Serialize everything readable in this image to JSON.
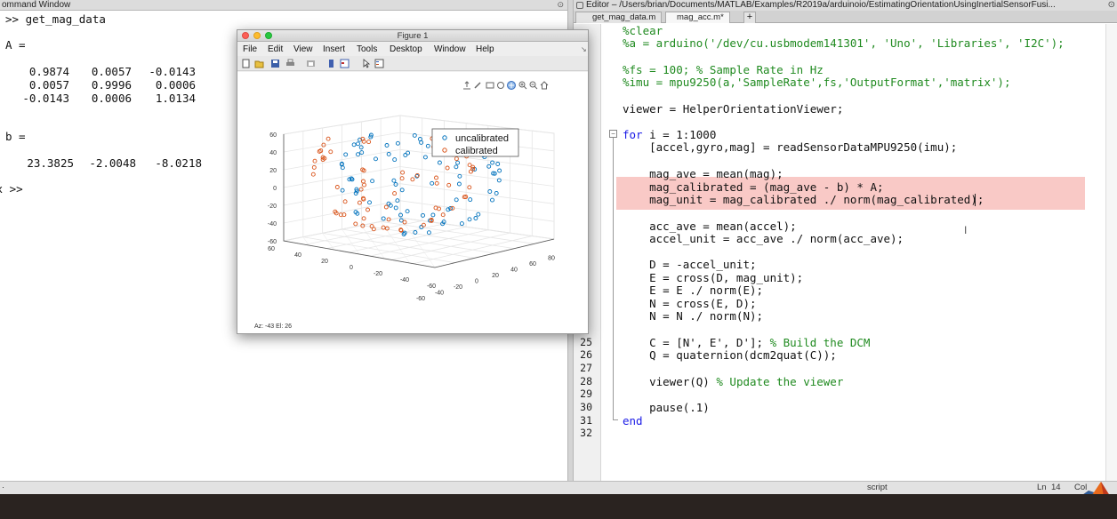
{
  "command_window": {
    "title": "ommand Window",
    "lines": [
      ">> get_mag_data",
      "A =",
      "b =",
      "fx >>"
    ],
    "matrix_A": [
      [
        "0.9874",
        "0.0057",
        "-0.0143"
      ],
      [
        "0.0057",
        "0.9996",
        "0.0006"
      ],
      [
        "-0.0143",
        "0.0006",
        "1.0134"
      ]
    ],
    "vector_b": [
      "23.3825",
      "-2.0048",
      "-8.0218"
    ]
  },
  "editor": {
    "title": "Editor – /Users/brian/Documents/MATLAB/Examples/R2019a/arduinoio/EstimatingOrientationUsingInertialSensorFusi...",
    "tabs": [
      {
        "label": "get_mag_data.m"
      },
      {
        "label": "mag_acc.m*"
      }
    ],
    "add_tab": "+",
    "line_numbers": [
      "25",
      "26",
      "27",
      "28",
      "29",
      "30",
      "31",
      "32"
    ],
    "code": [
      {
        "text": "%clear",
        "style": "cmt"
      },
      {
        "text": "%a = arduino('/dev/cu.usbmodem141301', 'Uno', 'Libraries', 'I2C');",
        "style": "cmt"
      },
      {
        "text": "%fs = 100; % Sample Rate in Hz",
        "style": "cmt"
      },
      {
        "text": "%imu = mpu9250(a,'SampleRate',fs,'OutputFormat','matrix');",
        "style": "cmt"
      },
      {
        "text": "viewer = HelperOrientationViewer;",
        "style": "plain"
      },
      {
        "text": "for",
        "style": "kw",
        "rest": " i = 1:1000"
      },
      {
        "text": "    [accel,gyro,mag] = readSensorDataMPU9250(imu);",
        "style": "plain"
      },
      {
        "text": "    mag_ave = mean(mag);",
        "style": "plain"
      },
      {
        "text": "    mag_calibrated = (mag_ave - b) * A;",
        "style": "plain"
      },
      {
        "text": "    mag_unit = mag_calibrated ./ norm(mag_calibrated);",
        "style": "plain"
      },
      {
        "text": "    acc_ave = mean(accel);",
        "style": "plain"
      },
      {
        "text": "    accel_unit = acc_ave ./ norm(acc_ave);",
        "style": "plain"
      },
      {
        "text": "    D = -accel_unit;",
        "style": "plain"
      },
      {
        "text": "    E = cross(D, mag_unit);",
        "style": "plain"
      },
      {
        "text": "    E = E ./ norm(E);",
        "style": "plain"
      },
      {
        "text": "    N = cross(E, D);",
        "style": "plain"
      },
      {
        "text": "    N = N ./ norm(N);",
        "style": "plain"
      },
      {
        "text": "    C = [N', E', D'];",
        "style": "plain",
        "comment": " % Build the DCM"
      },
      {
        "text": "    Q = quaternion(dcm2quat(C));",
        "style": "plain"
      },
      {
        "text": "    viewer(Q)",
        "style": "plain",
        "comment": " % Update the viewer"
      },
      {
        "text": "    pause(.1)",
        "style": "plain"
      },
      {
        "text": "end",
        "style": "kw"
      }
    ]
  },
  "status_bar": {
    "file_type": "script",
    "ln_label": "Ln",
    "ln_value": "14",
    "col_label": "Col"
  },
  "figure": {
    "title": "Figure 1",
    "menu": [
      "File",
      "Edit",
      "View",
      "Insert",
      "Tools",
      "Desktop",
      "Window",
      "Help"
    ],
    "az_el": "Az: -43 El: 26",
    "chart_data": {
      "type": "scatter",
      "title": "",
      "legend_position": "top-right",
      "series": [
        {
          "name": "uncalibrated",
          "color": "#0072bd"
        },
        {
          "name": "calibrated",
          "color": "#d95319"
        }
      ],
      "zticks": [
        "60",
        "40",
        "20",
        "0",
        "-20",
        "-40",
        "-60"
      ],
      "xticks": [
        "60",
        "40",
        "20",
        "0",
        "-20",
        "-40",
        "-60"
      ],
      "yticks": [
        "-60",
        "-40",
        "-20",
        "0",
        "20",
        "40",
        "60",
        "80"
      ],
      "grid": true,
      "view": {
        "azimuth": -43,
        "elevation": 26
      }
    }
  }
}
